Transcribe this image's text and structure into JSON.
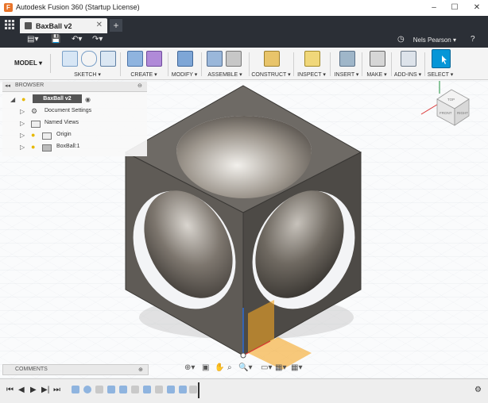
{
  "window": {
    "title": "Autodesk Fusion 360 (Startup License)",
    "app_icon": "F",
    "minimize": "–",
    "maximize": "☐",
    "close": "✕"
  },
  "tabs": {
    "doc_title": "BaxBall v2",
    "close": "✕",
    "new_tab": "+"
  },
  "user": {
    "name": "Nels Pearson ▾"
  },
  "workspace": {
    "label": "MODEL ▾"
  },
  "toolbar": {
    "groups": [
      {
        "label": "SKETCH ▾"
      },
      {
        "label": "CREATE ▾"
      },
      {
        "label": "MODIFY ▾"
      },
      {
        "label": "ASSEMBLE ▾"
      },
      {
        "label": "CONSTRUCT ▾"
      },
      {
        "label": "INSPECT ▾"
      },
      {
        "label": "INSERT ▾"
      },
      {
        "label": "MAKE ▾"
      },
      {
        "label": "ADD-INS ▾"
      },
      {
        "label": "SELECT ▾"
      }
    ]
  },
  "browser": {
    "title": "BROWSER",
    "root": "BaxBall v2",
    "items": [
      {
        "label": "Document Settings"
      },
      {
        "label": "Named Views"
      },
      {
        "label": "Origin"
      },
      {
        "label": "BoxBall:1"
      }
    ]
  },
  "comments": {
    "title": "COMMENTS"
  },
  "viewcube": {
    "top": "TOP",
    "front": "FRONT",
    "right": "RIGHT"
  },
  "colors": {
    "accent": "#0696d7",
    "dark_bar": "#2b2f36",
    "cube_fill": "#5a5651",
    "origin_plane": "#f5a623"
  }
}
